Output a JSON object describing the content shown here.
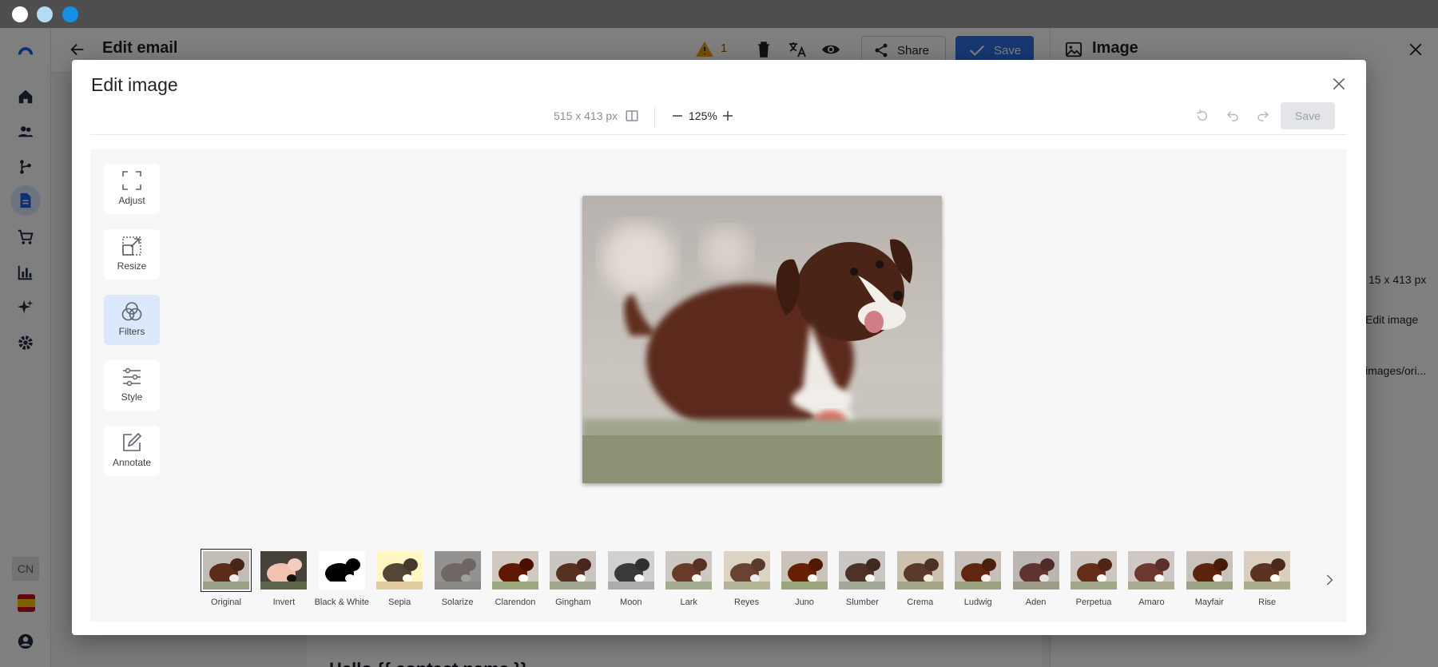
{
  "os_bar": {
    "dot_colors": [
      "#ffffff",
      "#b3dbf5",
      "#1291e6"
    ]
  },
  "app": {
    "title": "Edit email",
    "warning_count": "1",
    "share_label": "Share",
    "save_label": "Save",
    "lang_code": "CN",
    "email_heading": "Hello {{ contact.name }}",
    "right_panel": {
      "title": "Image",
      "dims_partial": "15 x 413 px",
      "edit_image_partial": "Edit image",
      "url_partial": "images/ori..."
    }
  },
  "modal": {
    "title": "Edit image",
    "toolbar": {
      "dimensions": "515 x 413 px",
      "zoom": "125%",
      "save_label": "Save"
    },
    "tools": [
      {
        "label": "Adjust",
        "icon": "adjust-icon",
        "active": false
      },
      {
        "label": "Resize",
        "icon": "resize-icon",
        "active": false
      },
      {
        "label": "Filters",
        "icon": "filters-icon",
        "active": true
      },
      {
        "label": "Style",
        "icon": "style-icon",
        "active": false
      },
      {
        "label": "Annotate",
        "icon": "annotate-icon",
        "active": false
      }
    ],
    "filters": [
      {
        "label": "Original",
        "selected": true
      },
      {
        "label": "Invert"
      },
      {
        "label": "Black & White"
      },
      {
        "label": "Sepia"
      },
      {
        "label": "Solarize"
      },
      {
        "label": "Clarendon"
      },
      {
        "label": "Gingham"
      },
      {
        "label": "Moon"
      },
      {
        "label": "Lark"
      },
      {
        "label": "Reyes"
      },
      {
        "label": "Juno"
      },
      {
        "label": "Slumber"
      },
      {
        "label": "Crema"
      },
      {
        "label": "Ludwig"
      },
      {
        "label": "Aden"
      },
      {
        "label": "Perpetua"
      },
      {
        "label": "Amaro"
      },
      {
        "label": "Mayfair"
      },
      {
        "label": "Rise"
      }
    ]
  }
}
